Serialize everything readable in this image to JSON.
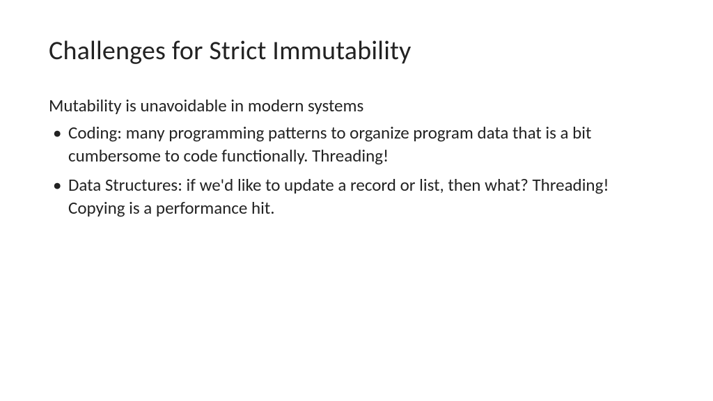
{
  "slide": {
    "title": "Challenges for Strict Immutability",
    "subtitle": "Mutability is unavoidable in modern systems",
    "bullets": [
      "Coding: many programming patterns to organize program data that is a bit cumbersome to code functionally. Threading!",
      "Data Structures: if we'd like to update a record or list, then what? Threading! Copying is a performance hit."
    ]
  }
}
